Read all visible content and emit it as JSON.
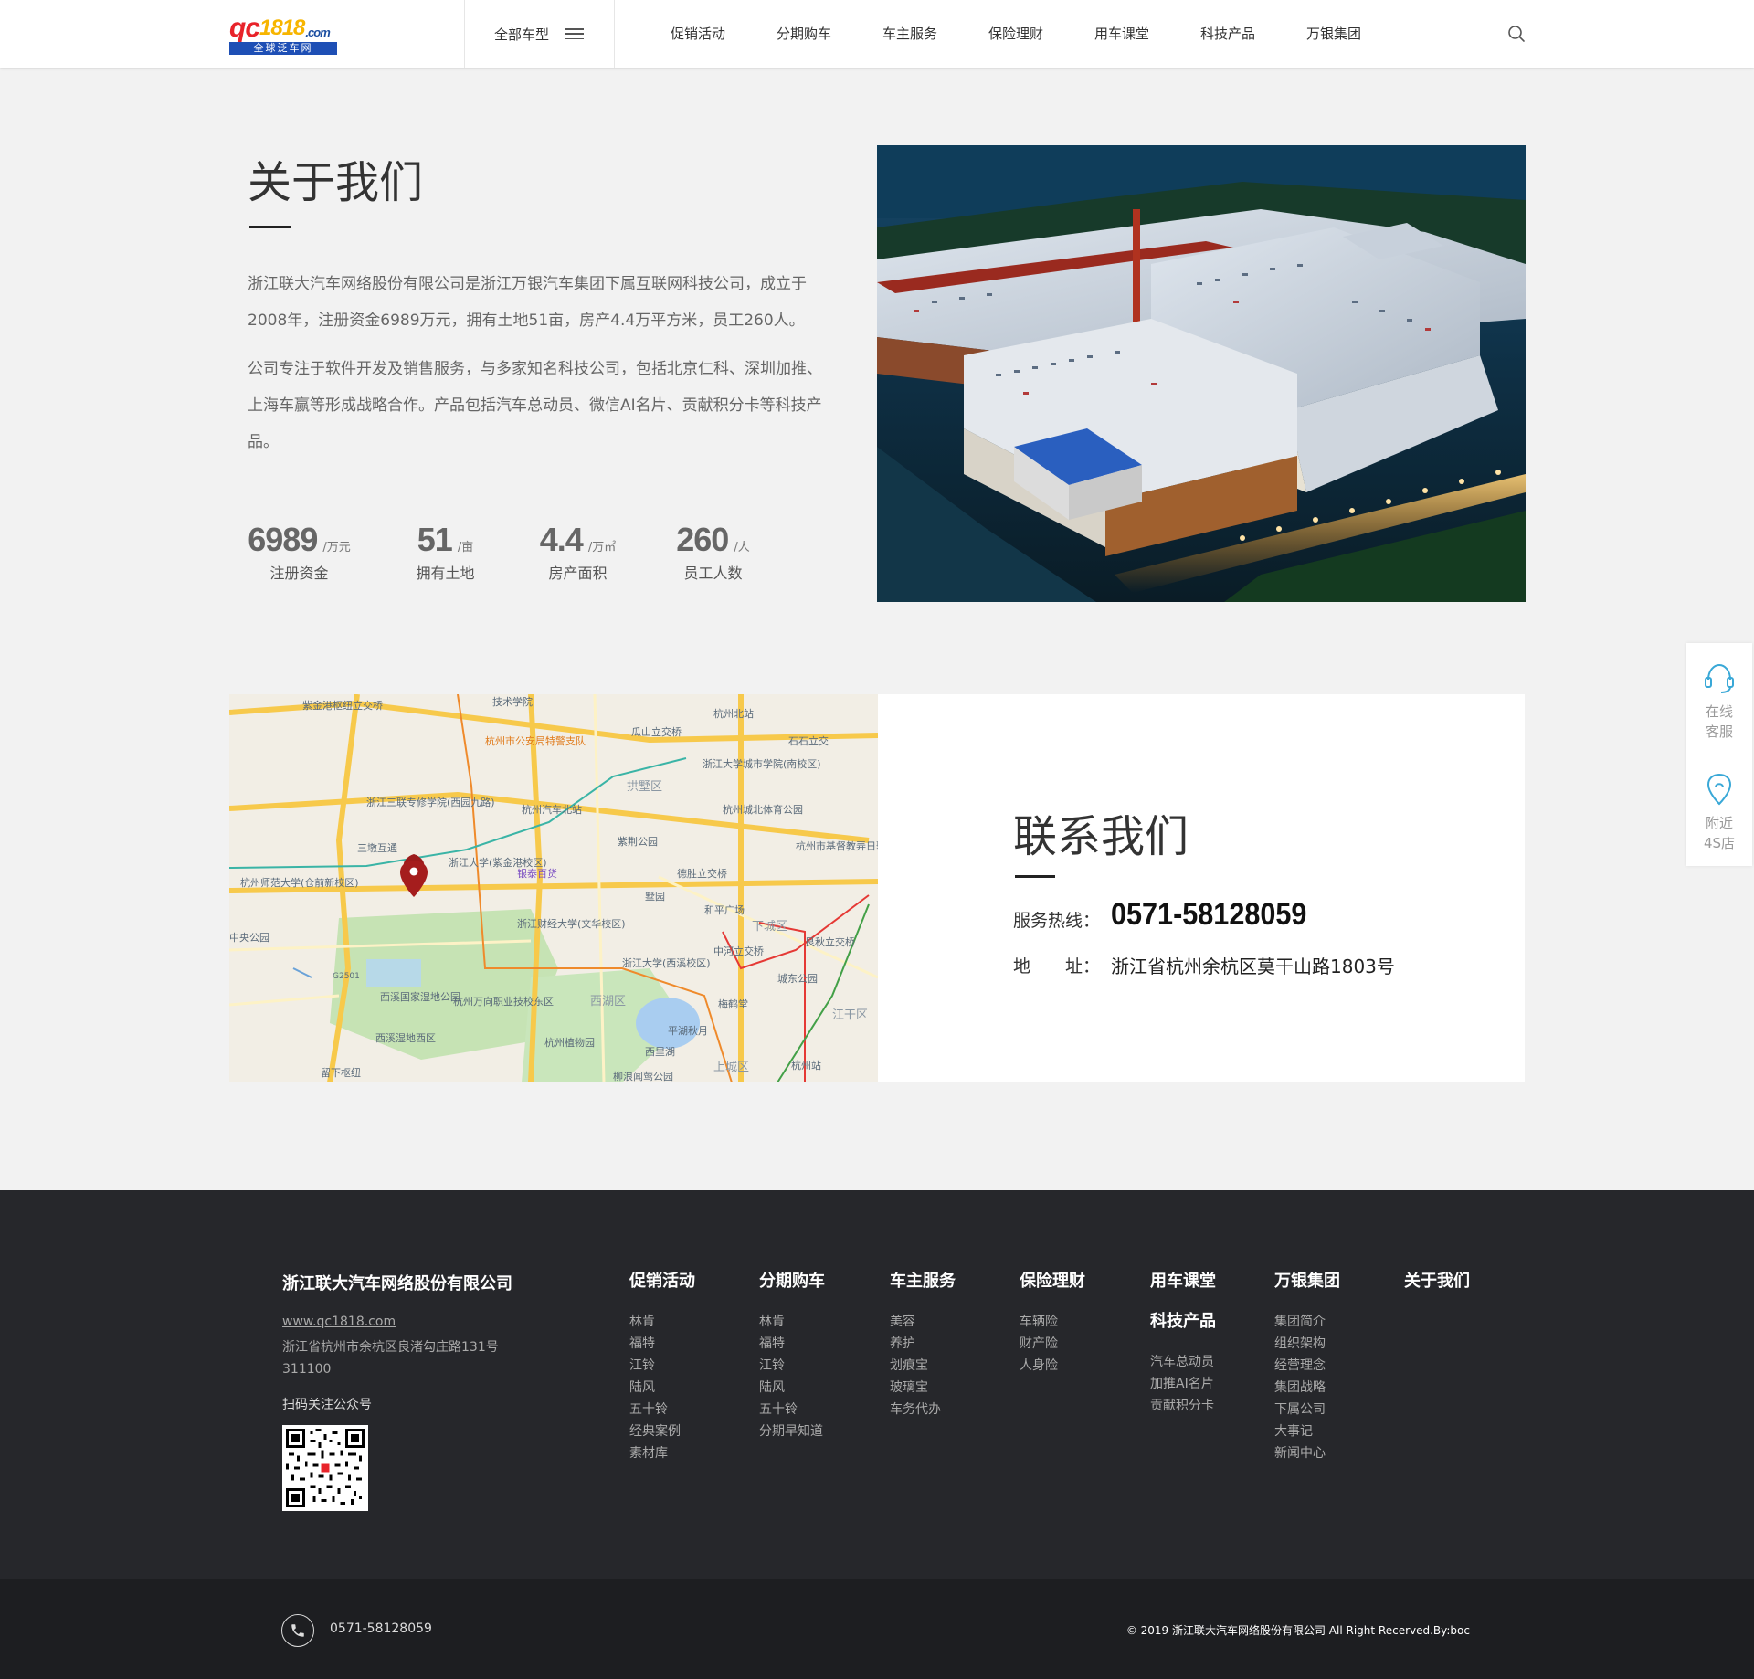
{
  "header": {
    "logo": {
      "brand_q": "qc",
      "brand_n": "1818",
      "brand_com": ".com",
      "tagline": "全球泛车网"
    },
    "all_models": "全部车型",
    "nav": [
      "促销活动",
      "分期购车",
      "车主服务",
      "保险理财",
      "用车课堂",
      "科技产品",
      "万银集团"
    ]
  },
  "about": {
    "title": "关于我们",
    "para1": "浙江联大汽车网络股份有限公司是浙江万银汽车集团下属互联网科技公司，成立于2008年，注册资金6989万元，拥有土地51亩，房产4.4万平方米，员工260人。",
    "para2": "公司专注于软件开发及销售服务，与多家知名科技公司，包括北京仁科、深圳加推、上海车赢等形成战略合作。产品包括汽车总动员、微信AI名片、贡献积分卡等科技产品。",
    "stats": [
      {
        "num": "6989",
        "unit": "/万元",
        "label": "注册资金"
      },
      {
        "num": "51",
        "unit": "/亩",
        "label": "拥有土地"
      },
      {
        "num": "4.4",
        "unit": "/万㎡",
        "label": "房产面积"
      },
      {
        "num": "260",
        "unit": "/人",
        "label": "员工人数"
      }
    ]
  },
  "map": {
    "labels": [
      "紫金港枢纽立交桥",
      "技术学院",
      "杭州北站",
      "杭州市公安局特警支队",
      "瓜山立交桥",
      "石石立交",
      "浙江大学城市学院(南校区)",
      "拱墅区",
      "浙江三联专修学院(西园九路)",
      "杭州汽车北站",
      "杭州城北体育公园",
      "三墩互通",
      "紫荆公园",
      "浙江大学(紫金港校区)",
      "杭州市基督教弄日聚会点",
      "银泰百货",
      "德胜立交桥",
      "杭州师范大学(仓前新校区)",
      "墅园",
      "和平广场",
      "浙江财经大学(文华校区)",
      "下城区",
      "中央公园",
      "艮秋立交桥",
      "中河立交桥",
      "浙江大学(西溪校区)",
      "城东公园",
      "西溪国家湿地公园",
      "杭州万向职业技校东区",
      "西湖区",
      "梅鹤堂",
      "江干区",
      "平湖秋月",
      "西溪湿地西区",
      "杭州植物园",
      "西里湖",
      "杭州站",
      "上城区",
      "留下枢纽",
      "柳浪闻莺公园",
      "G2501"
    ]
  },
  "contact": {
    "title": "联系我们",
    "hotline_label": "服务热线：",
    "hotline": "0571-58128059",
    "address_label": "地　　址：",
    "address": "浙江省杭州余杭区莫干山路1803号"
  },
  "float": [
    {
      "label1": "在线",
      "label2": "客服"
    },
    {
      "label1": "附近",
      "label2": "4S店"
    }
  ],
  "footer": {
    "company": "浙江联大汽车网络股份有限公司",
    "site": "www.qc1818.com",
    "address_line1": "浙江省杭州市余杭区良渚勾庄路131号",
    "address_line2": "311100",
    "qr_label": "扫码关注公众号",
    "columns": [
      {
        "title": "促销活动",
        "items": [
          "林肯",
          "福特",
          "江铃",
          "陆风",
          "五十铃",
          "经典案例",
          "素材库"
        ]
      },
      {
        "title": "分期购车",
        "items": [
          "林肯",
          "福特",
          "江铃",
          "陆风",
          "五十铃",
          "分期早知道"
        ]
      },
      {
        "title": "车主服务",
        "items": [
          "美容",
          "养护",
          "划痕宝",
          "玻璃宝",
          "车务代办"
        ]
      },
      {
        "title": "保险理财",
        "items": [
          "车辆险",
          "财产险",
          "人身险"
        ]
      },
      {
        "title": "用车课堂",
        "title2": "科技产品",
        "items": [
          "汽车总动员",
          "加推AI名片",
          "贡献积分卡"
        ]
      },
      {
        "title": "万银集团",
        "items": [
          "集团简介",
          "组织架构",
          "经营理念",
          "集团战略",
          "下属公司",
          "大事记",
          "新闻中心"
        ]
      },
      {
        "title": "关于我们",
        "items": []
      }
    ],
    "bottom_phone": "0571-58128059",
    "copyright": "© 2019 浙江联大汽车网络股份有限公司 All Right Recerved.By:boc"
  }
}
